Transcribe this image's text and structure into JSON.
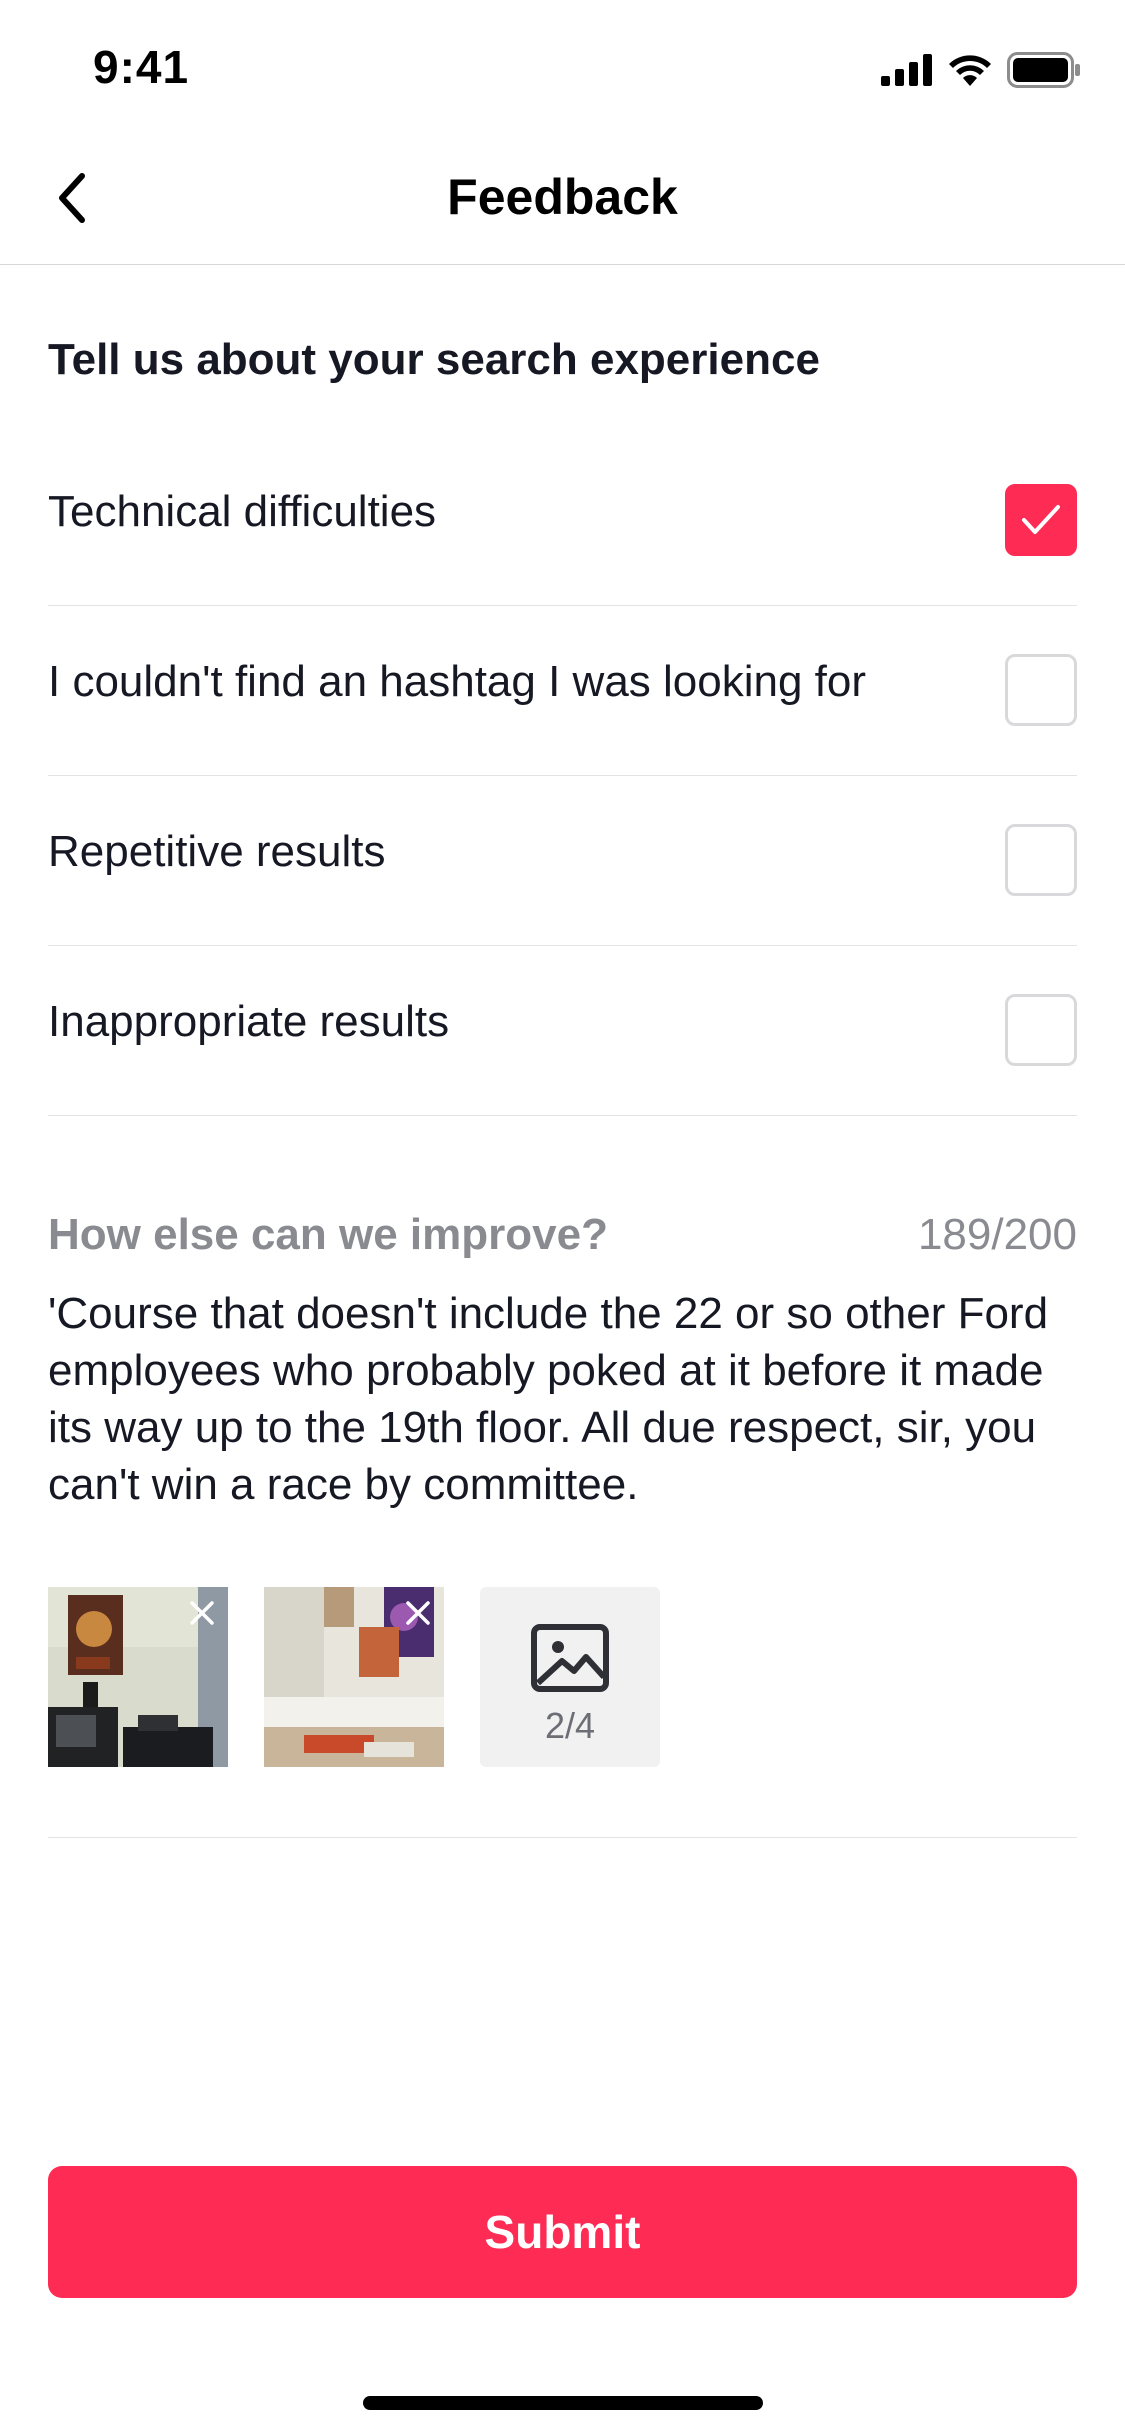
{
  "status_bar": {
    "time": "9:41",
    "icons": [
      "cellular-signal-icon",
      "wifi-icon",
      "battery-icon"
    ]
  },
  "nav": {
    "title": "Feedback",
    "back_icon": "chevron-left-icon"
  },
  "survey": {
    "title": "Tell us about your search experience",
    "options": [
      {
        "label": "Technical difficulties",
        "checked": true
      },
      {
        "label": "I couldn't find an hashtag I was looking for",
        "checked": false
      },
      {
        "label": "Repetitive results",
        "checked": false
      },
      {
        "label": "Inappropriate results",
        "checked": false
      }
    ]
  },
  "improve": {
    "label": "How else can we improve?",
    "count": "189/200",
    "text": "'Course that doesn't include the 22 or so other Ford employees who probably poked at it before it made its way up to the 19th floor. All due respect, sir, you can't win a race by committee."
  },
  "attachments": {
    "images": [
      "photo-thumbnail-1",
      "photo-thumbnail-2"
    ],
    "add_icon": "image-icon",
    "add_count": "2/4"
  },
  "submit": {
    "label": "Submit"
  },
  "colors": {
    "accent": "#fe2c55",
    "text_primary": "#161823",
    "text_secondary": "#8a8b91",
    "divider": "#e3e3e4"
  }
}
